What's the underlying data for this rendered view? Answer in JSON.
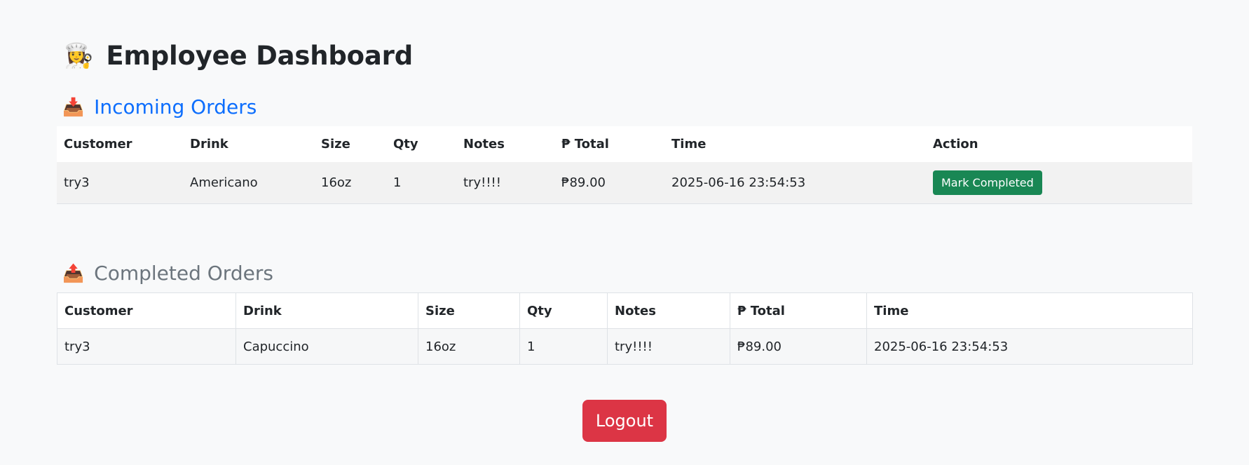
{
  "page": {
    "title": "Employee Dashboard",
    "title_icon": "👩‍🍳"
  },
  "incoming": {
    "heading": "Incoming Orders",
    "icon": "📥",
    "columns": [
      "Customer",
      "Drink",
      "Size",
      "Qty",
      "Notes",
      "₱ Total",
      "Time",
      "Action"
    ],
    "rows": [
      {
        "customer": "try3",
        "drink": "Americano",
        "size": "16oz",
        "qty": "1",
        "notes": "try!!!!",
        "total": "₱89.00",
        "time": "2025-06-16 23:54:53",
        "action_label": "Mark Completed"
      }
    ]
  },
  "completed": {
    "heading": "Completed Orders",
    "icon": "📤",
    "columns": [
      "Customer",
      "Drink",
      "Size",
      "Qty",
      "Notes",
      "₱ Total",
      "Time"
    ],
    "rows": [
      {
        "customer": "try3",
        "drink": "Capuccino",
        "size": "16oz",
        "qty": "1",
        "notes": "try!!!!",
        "total": "₱89.00",
        "time": "2025-06-16 23:54:53"
      }
    ]
  },
  "logout_label": "Logout",
  "colors": {
    "incoming_heading": "#0d6efd",
    "completed_heading": "#6c757d",
    "mark_button": "#198754",
    "logout_button": "#dc3545",
    "background": "#f8f9fa"
  }
}
